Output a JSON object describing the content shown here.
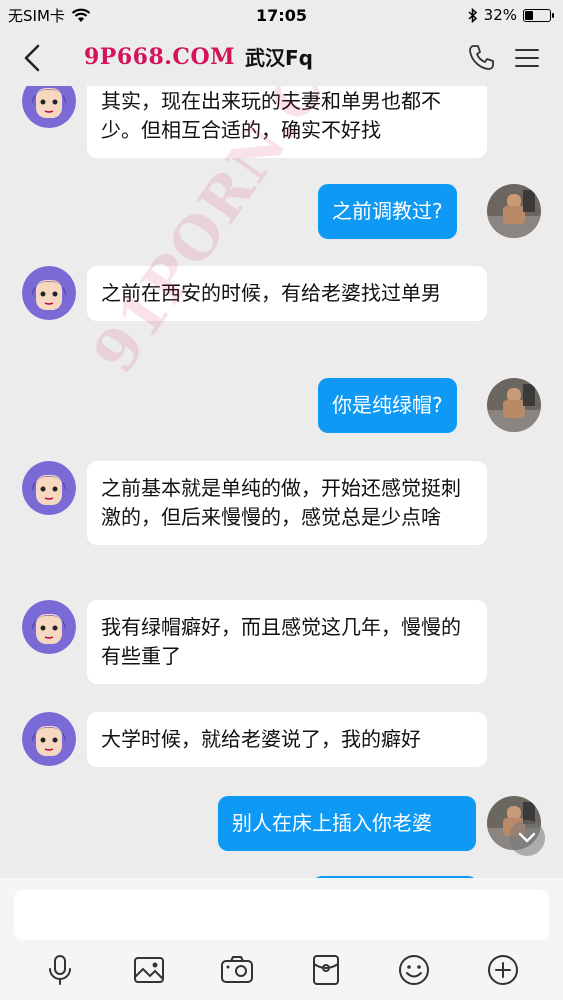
{
  "status_bar": {
    "carrier": "无SIM卡",
    "time": "17:05",
    "battery": "32%",
    "battery_level": 0.32
  },
  "nav": {
    "brand": "9P668.COM",
    "title": "武汉Fq"
  },
  "watermark": "91PORN.COM",
  "messages": [
    {
      "side": "in",
      "text": "其实，现在出来玩的夫妻和单男也都不少。但相互合适的，确实不好找"
    },
    {
      "side": "out",
      "text": "之前调教过?"
    },
    {
      "side": "in",
      "text": "之前在西安的时候，有给老婆找过单男"
    },
    {
      "side": "out",
      "text": "你是纯绿帽?"
    },
    {
      "side": "in",
      "text": "之前基本就是单纯的做，开始还感觉挺刺激的，但后来慢慢的，感觉总是少点啥"
    },
    {
      "side": "in",
      "text": "我有绿帽癖好，而且感觉这几年，慢慢的有些重了"
    },
    {
      "side": "in",
      "text": "大学时候，就给老婆说了，我的癖好"
    },
    {
      "side": "out",
      "text": "别人在床上插入你老婆"
    }
  ],
  "composer": {
    "placeholder": ""
  },
  "colors": {
    "background": "#ececec",
    "bubble_out": "#0e99f5",
    "bubble_in": "#ffffff",
    "brand": "#d4145a"
  },
  "icons": [
    "back-chevron-icon",
    "phone-icon",
    "menu-icon",
    "microphone-icon",
    "image-icon",
    "camera-icon",
    "red-packet-icon",
    "emoji-icon",
    "add-icon",
    "chevron-down-icon"
  ]
}
